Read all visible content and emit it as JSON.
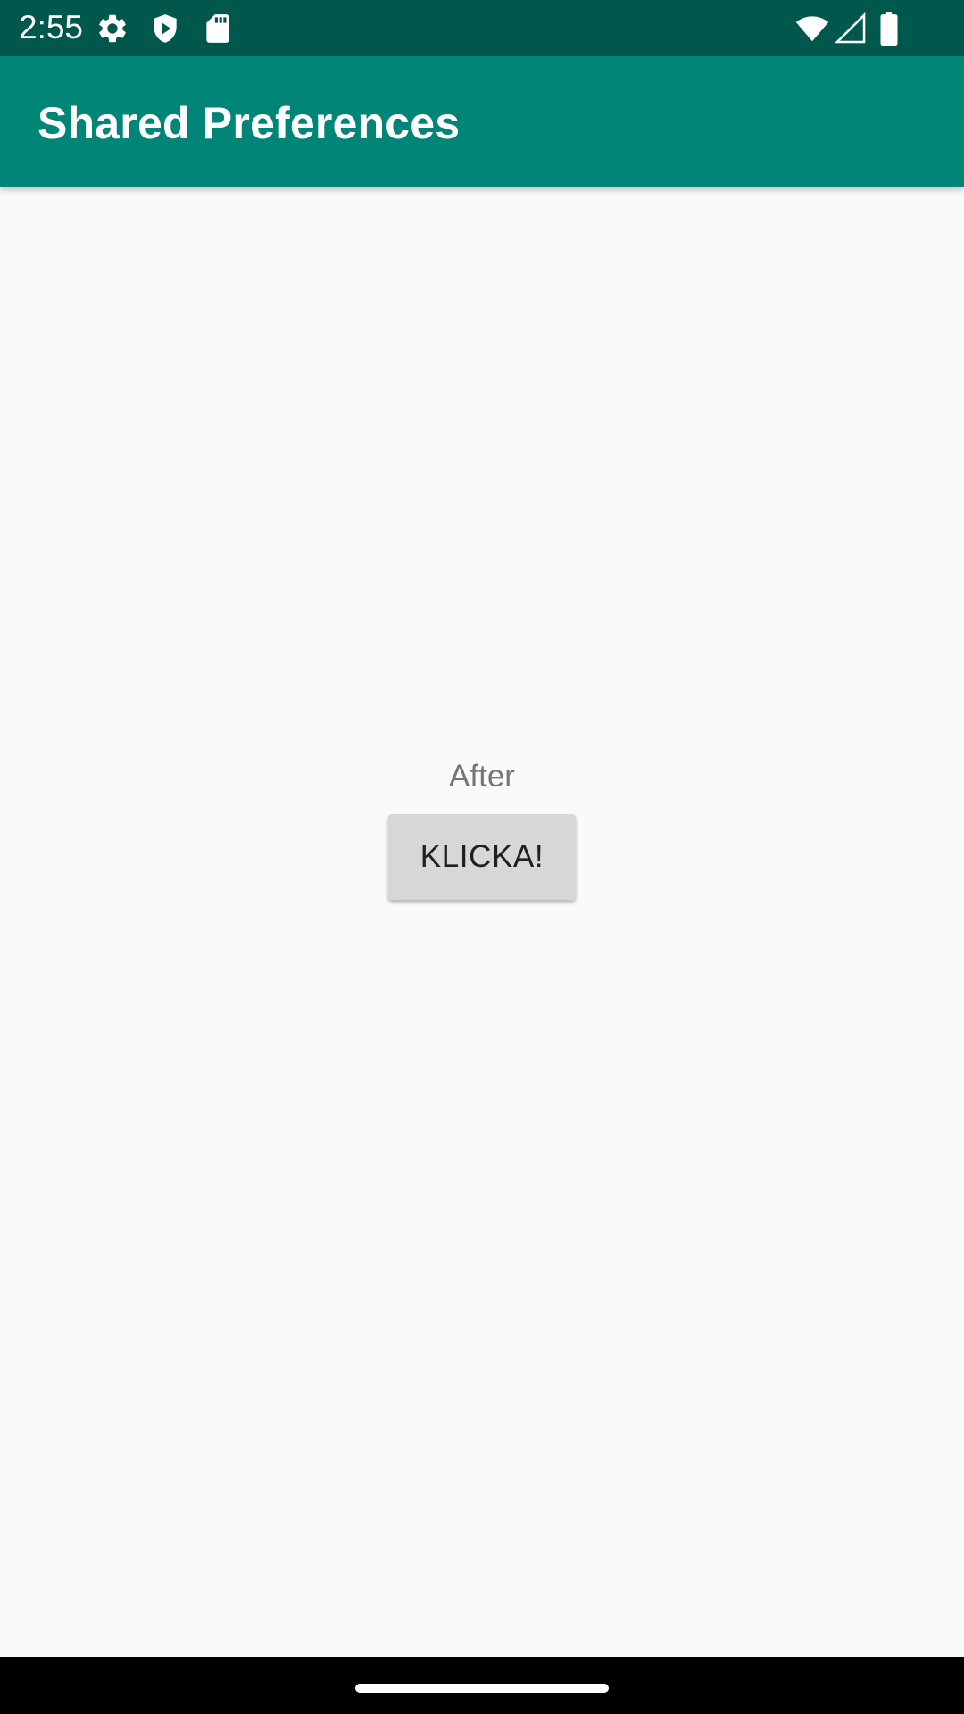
{
  "status_bar": {
    "time": "2:55",
    "left_icons": [
      "settings-gear-icon",
      "shield-play-icon",
      "sd-card-icon"
    ],
    "right_icons": [
      "wifi-icon",
      "cell-signal-icon",
      "battery-icon"
    ],
    "background": "#00574b"
  },
  "app_bar": {
    "title": "Shared Preferences",
    "background": "#008577"
  },
  "main": {
    "label": "After",
    "button_label": "KLICKA!"
  },
  "nav_bar": {
    "home_indicator": "home-handle"
  }
}
